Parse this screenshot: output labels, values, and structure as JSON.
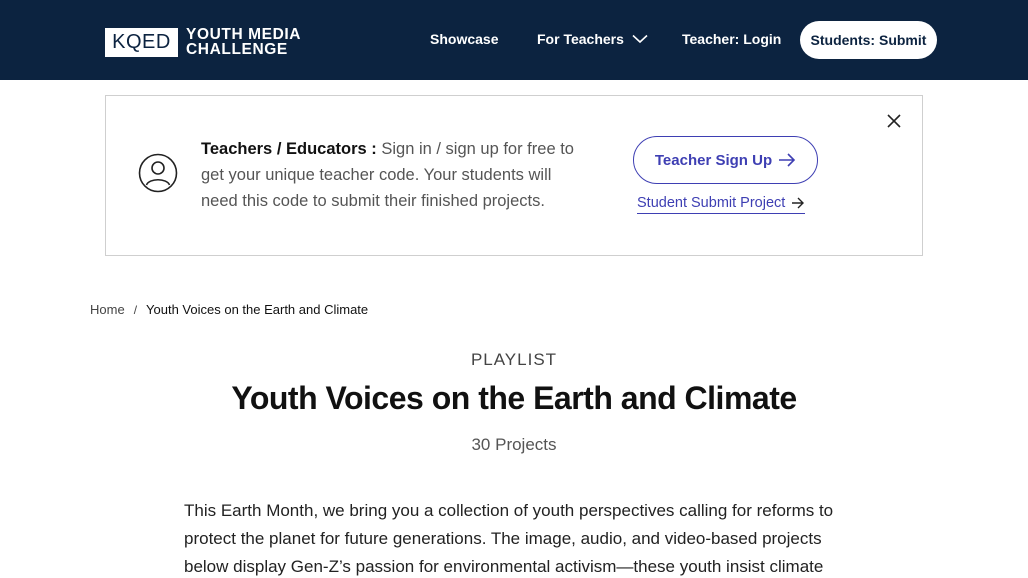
{
  "header": {
    "logo_mark": "KQED",
    "logo_line1": "YOUTH MEDIA",
    "logo_line2": "CHALLENGE",
    "nav": {
      "showcase": "Showcase",
      "for_teachers": "For Teachers",
      "teacher_login": "Teacher: Login",
      "students_submit": "Students: Submit"
    }
  },
  "banner": {
    "heading": "Teachers / Educators :",
    "body": " Sign in / sign up for free to get your unique teacher code. Your students will need this code to submit their finished projects.",
    "signup_label": "Teacher Sign Up",
    "student_link": "Student Submit Project"
  },
  "breadcrumb": {
    "home": "Home",
    "separator": "/",
    "current": "Youth Voices on the Earth and Climate"
  },
  "main": {
    "kicker": "PLAYLIST",
    "title": "Youth Voices on the Earth and Climate",
    "count": "30 Projects",
    "description": "This Earth Month, we bring you a collection of youth perspectives calling for reforms to protect the planet for future generations. The image, audio, and video-based projects below display Gen-Z’s passion for environmental activism—these youth insist climate"
  },
  "colors": {
    "header_bg": "#0c2340",
    "accent": "#3e3fb3"
  },
  "icons": [
    "chevron-down-icon",
    "user-avatar-icon",
    "close-icon",
    "arrow-right-icon"
  ]
}
